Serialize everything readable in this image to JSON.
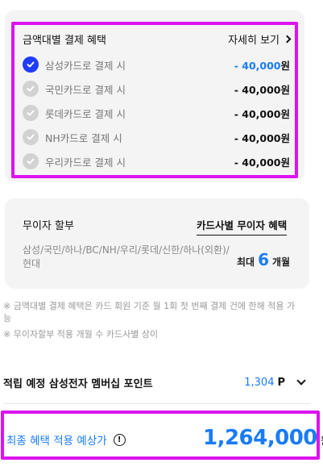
{
  "benefit": {
    "title": "금액대별 결제 혜택",
    "detail_link": "자세히 보기",
    "currency": "원",
    "items": [
      {
        "card": "삼성카드로 결제 시",
        "amount": "- 40,000",
        "selected": true
      },
      {
        "card": "국민카드로 결제 시",
        "amount": "- 40,000",
        "selected": false
      },
      {
        "card": "롯데카드로 결제 시",
        "amount": "- 40,000",
        "selected": false
      },
      {
        "card": "NH카드로 결제 시",
        "amount": "- 40,000",
        "selected": false
      },
      {
        "card": "우리카드로 결제 시",
        "amount": "- 40,000",
        "selected": false
      }
    ]
  },
  "installment": {
    "label": "무이자 할부",
    "link": "카드사별 무이자 혜택",
    "cards": "삼성/국민/하나/BC/NH/우리/롯데/신한/하나(외환)/현대",
    "max_prefix": "최대",
    "max_months": "6",
    "max_suffix": "개월"
  },
  "notes": [
    "※ 금액대별 결제 혜택은 카드 회원 기준 월 1회 첫 번째 결제 건에 한해 적용 가능",
    "※ 무이자할부 적용 개월 수 카드사별 상이"
  ],
  "points": {
    "label": "적립 예정 삼성전자 멤버십 포인트",
    "value": "1,304",
    "unit": "P"
  },
  "final": {
    "label": "최종 혜택 적용 예상가",
    "info_icon": "!",
    "price": "1,264,000",
    "currency": "원"
  },
  "colors": {
    "accent_blue": "#1a7cf5",
    "check_selected": "#1f3cff",
    "highlight_magenta": "#dc13f0"
  }
}
